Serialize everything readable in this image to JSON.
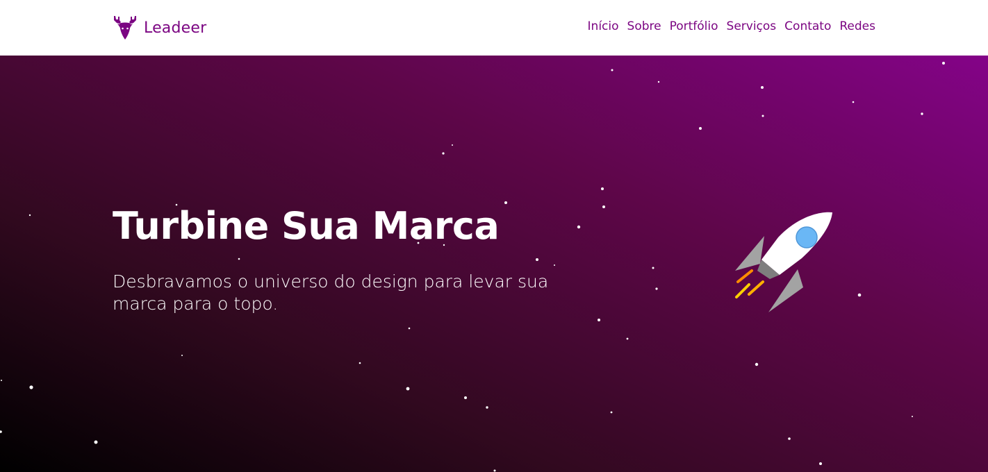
{
  "navbar": {
    "brand_name": "Leadeer",
    "brand_icon": "deer-head-icon",
    "links": [
      "Início",
      "Sobre",
      "Portfólio",
      "Serviços",
      "Contato",
      "Redes"
    ]
  },
  "hero": {
    "title": "Turbine Sua Marca",
    "subtitle": "Desbravamos o universo do design para levar sua marca para o topo.",
    "illustration": "rocket-icon"
  },
  "colors": {
    "brand": "#7b0582",
    "hero_gradient": [
      "#840388",
      "#5e0649",
      "#31091f",
      "#000000"
    ],
    "rocket_window": "#6ab7f5"
  }
}
